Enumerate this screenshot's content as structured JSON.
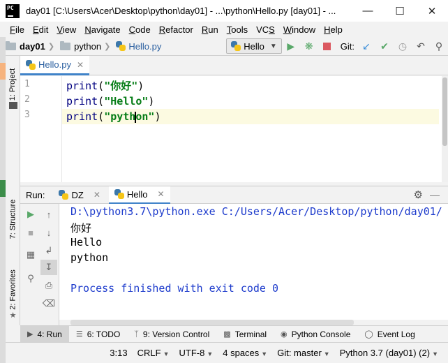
{
  "window": {
    "title": "day01 [C:\\Users\\Acer\\Desktop\\python\\day01] - ...\\python\\Hello.py [day01] - ...",
    "logo": "PC"
  },
  "menu": [
    "File",
    "Edit",
    "View",
    "Navigate",
    "Code",
    "Refactor",
    "Run",
    "Tools",
    "VCS",
    "Window",
    "Help"
  ],
  "menu_mnemonics": [
    "F",
    "E",
    "V",
    "N",
    "C",
    "R",
    "R",
    "T",
    "S",
    "W",
    "H"
  ],
  "breadcrumbs": [
    "day01",
    "python",
    "Hello.py"
  ],
  "toolbar": {
    "run_config": "Hello",
    "git_label": "Git:"
  },
  "left_tabs": {
    "project": "1: Project",
    "structure": "7: Structure",
    "favorites": "2: Favorites"
  },
  "editor": {
    "tab": "Hello.py",
    "lines": [
      {
        "no": "1",
        "fn": "print",
        "arg": "\"你好\""
      },
      {
        "no": "2",
        "fn": "print",
        "arg": "\"Hello\""
      },
      {
        "no": "3",
        "fn": "print",
        "arg_before_caret": "\"pyth",
        "arg_after_caret": "on\""
      }
    ]
  },
  "run": {
    "label": "Run:",
    "tabs": [
      "DZ",
      "Hello"
    ],
    "console": [
      "D:\\python3.7\\python.exe C:/Users/Acer/Desktop/python/day01/",
      "你好",
      "Hello",
      "python",
      "",
      "Process finished with exit code 0"
    ]
  },
  "bottom_tabs": [
    {
      "label": "4: Run",
      "icon": "run-icon"
    },
    {
      "label": "6: TODO",
      "icon": "todo-icon"
    },
    {
      "label": "9: Version Control",
      "icon": "vcs-icon"
    },
    {
      "label": "Terminal",
      "icon": "terminal-icon"
    },
    {
      "label": "Python Console",
      "icon": "python-console-icon"
    },
    {
      "label": "Event Log",
      "icon": "event-log-icon"
    }
  ],
  "status": {
    "position": "3:13",
    "line_sep": "CRLF",
    "encoding": "UTF-8",
    "indent": "4 spaces",
    "git": "Git: master",
    "interpreter": "Python 3.7 (day01) (2)"
  },
  "colors": {
    "accent": "#4083c9",
    "run_green": "#59a869",
    "stop_red": "#db5860",
    "console_blue": "#1d3bcc",
    "string_green": "#067d17"
  }
}
